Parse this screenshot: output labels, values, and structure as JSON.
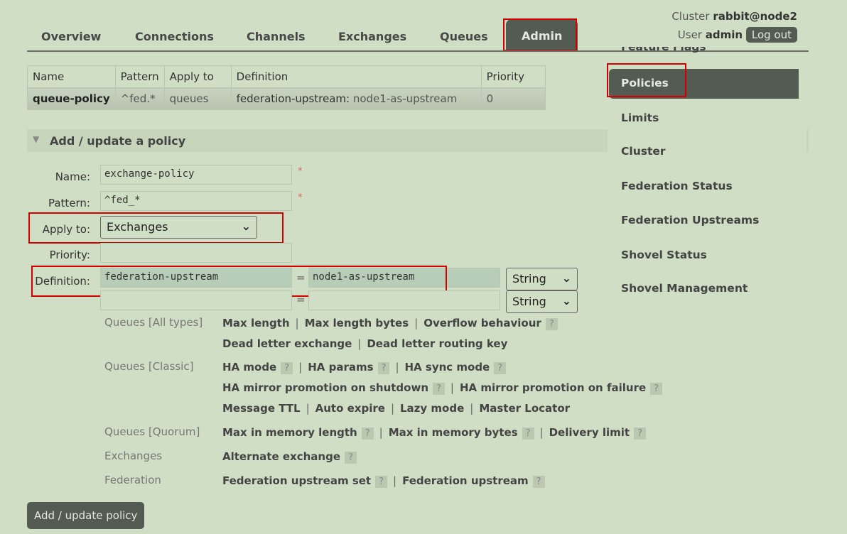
{
  "nav": {
    "tabs": [
      "Overview",
      "Connections",
      "Channels",
      "Exchanges",
      "Queues",
      "Admin"
    ],
    "active": "Admin"
  },
  "header": {
    "cluster_label": "Cluster",
    "cluster_name": "rabbit@node2",
    "user_label": "User",
    "user_name": "admin",
    "logout": "Log out"
  },
  "policies_table": {
    "columns": [
      "Name",
      "Pattern",
      "Apply to",
      "Definition",
      "Priority"
    ],
    "rows": [
      {
        "name": "queue-policy",
        "pattern": "^fed.*",
        "apply_to": "queues",
        "definition_key": "federation-upstream:",
        "definition_value": "node1-as-upstream",
        "priority": "0"
      }
    ]
  },
  "section": {
    "title": "Add / update a policy"
  },
  "form": {
    "name_label": "Name:",
    "name_value": "exchange-policy",
    "pattern_label": "Pattern:",
    "pattern_value": "^fed_*",
    "apply_label": "Apply to:",
    "apply_value": "Exchanges",
    "priority_label": "Priority:",
    "priority_value": "",
    "definition_label": "Definition:",
    "def1_key": "federation-upstream",
    "def1_value": "node1-as-upstream",
    "def1_type": "String",
    "def2_key": "",
    "def2_value": "",
    "def2_type": "String",
    "eq": "=",
    "required": "*",
    "submit": "Add / update policy"
  },
  "help": {
    "q": "?",
    "categories": [
      {
        "name": "Queues [All types]",
        "lines": [
          [
            [
              "Max length",
              false
            ],
            [
              "Max length bytes",
              false
            ],
            [
              "Overflow behaviour",
              true
            ]
          ],
          [
            [
              "Dead letter exchange",
              false
            ],
            [
              "Dead letter routing key",
              false
            ]
          ]
        ]
      },
      {
        "name": "Queues [Classic]",
        "lines": [
          [
            [
              "HA mode",
              true
            ],
            [
              "HA params",
              true
            ],
            [
              "HA sync mode",
              true
            ]
          ],
          [
            [
              "HA mirror promotion on shutdown",
              true
            ],
            [
              "HA mirror promotion on failure",
              true
            ]
          ],
          [
            [
              "Message TTL",
              false
            ],
            [
              "Auto expire",
              false
            ],
            [
              "Lazy mode",
              false
            ],
            [
              "Master Locator",
              false
            ]
          ]
        ]
      },
      {
        "name": "Queues [Quorum]",
        "lines": [
          [
            [
              "Max in memory length",
              true
            ],
            [
              "Max in memory bytes",
              true
            ],
            [
              "Delivery limit",
              true
            ]
          ]
        ]
      },
      {
        "name": "Exchanges",
        "lines": [
          [
            [
              "Alternate exchange",
              true
            ]
          ]
        ]
      },
      {
        "name": "Federation",
        "lines": [
          [
            [
              "Federation upstream set",
              true
            ],
            [
              "Federation upstream",
              true
            ]
          ]
        ]
      }
    ]
  },
  "sidebar": {
    "partial": "Feature Flags",
    "items": [
      "Policies",
      "Limits",
      "Cluster",
      "Federation Status",
      "Federation Upstreams",
      "Shovel Status",
      "Shovel Management"
    ],
    "active": "Policies"
  }
}
